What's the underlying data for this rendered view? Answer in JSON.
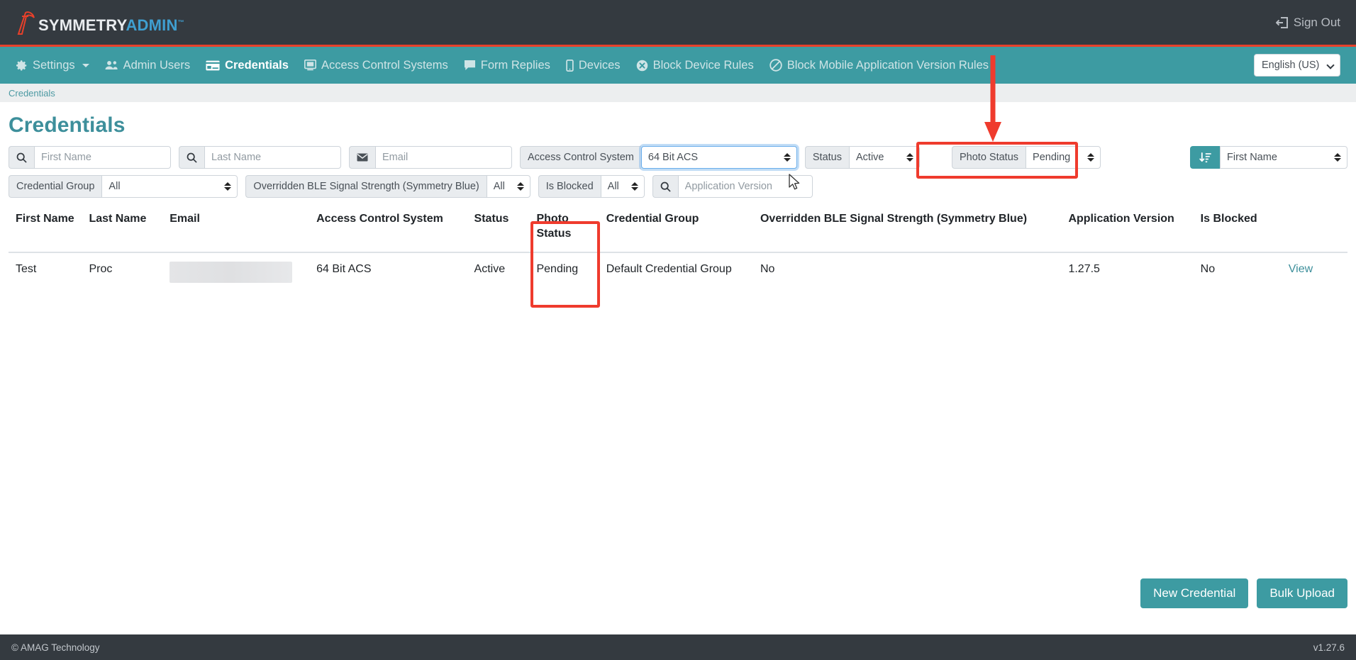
{
  "brand": {
    "logo_symmetry": "SYMMETRY",
    "logo_admin": "ADMIN",
    "logo_tm": "™",
    "accent_teal": "#3d9ba2",
    "accent_red": "#ef3b2d",
    "dark": "#343a40"
  },
  "topbar": {
    "signout_label": "Sign Out"
  },
  "nav": {
    "items": [
      {
        "label": "Settings",
        "icon": "gear-icon",
        "active": false,
        "caret": true
      },
      {
        "label": "Admin Users",
        "icon": "users-icon",
        "active": false
      },
      {
        "label": "Credentials",
        "icon": "card-icon",
        "active": true
      },
      {
        "label": "Access Control Systems",
        "icon": "server-icon",
        "active": false
      },
      {
        "label": "Form Replies",
        "icon": "comment-icon",
        "active": false
      },
      {
        "label": "Devices",
        "icon": "mobile-icon",
        "active": false
      },
      {
        "label": "Block Device Rules",
        "icon": "times-circle-icon",
        "active": false
      },
      {
        "label": "Block Mobile Application Version Rules",
        "icon": "ban-icon",
        "active": false
      }
    ],
    "language_selected": "English (US)"
  },
  "breadcrumb": {
    "text": "Credentials"
  },
  "page": {
    "title": "Credentials"
  },
  "filters": {
    "row1": [
      {
        "name": "first-name",
        "addon_icon": "search-icon",
        "type": "input",
        "placeholder": "First Name",
        "value": ""
      },
      {
        "name": "last-name",
        "addon_icon": "search-icon",
        "type": "input",
        "placeholder": "Last Name",
        "value": ""
      },
      {
        "name": "email",
        "addon_icon": "envelope-icon",
        "type": "input",
        "placeholder": "Email",
        "value": ""
      },
      {
        "name": "access-control-system",
        "addon_label": "Access Control System",
        "type": "select",
        "value": "64 Bit ACS",
        "focused": true
      },
      {
        "name": "status",
        "addon_label": "Status",
        "type": "select",
        "value": "Active"
      },
      {
        "name": "photo-status",
        "addon_label": "Photo Status",
        "type": "select",
        "value": "Pending",
        "highlighted": true
      }
    ],
    "sort": {
      "label": "First Name",
      "icon": "sort-amount-down-icon"
    },
    "row2": [
      {
        "name": "credential-group",
        "addon_label": "Credential Group",
        "type": "select",
        "value": "All"
      },
      {
        "name": "overridden-ble-signal-strength",
        "addon_label": "Overridden BLE Signal Strength (Symmetry Blue)",
        "type": "select",
        "value": "All"
      },
      {
        "name": "is-blocked",
        "addon_label": "Is Blocked",
        "type": "select",
        "value": "All"
      },
      {
        "name": "application-version",
        "addon_icon": "search-icon",
        "type": "input",
        "placeholder": "Application Version",
        "value": ""
      }
    ]
  },
  "table": {
    "columns": [
      "First Name",
      "Last Name",
      "Email",
      "Access Control System",
      "Status",
      "Photo Status",
      "Credential Group",
      "Overridden BLE Signal Strength (Symmetry Blue)",
      "Application Version",
      "Is Blocked",
      ""
    ],
    "rows": [
      {
        "first_name": "Test",
        "last_name": "Proc",
        "email": "",
        "email_redacted": true,
        "access_control_system": "64 Bit ACS",
        "status": "Active",
        "photo_status": "Pending",
        "credential_group": "Default Credential Group",
        "overridden_ble": "No",
        "application_version": "1.27.5",
        "is_blocked": "No",
        "action": "View"
      }
    ]
  },
  "actions": {
    "new_credential": "New Credential",
    "bulk_upload": "Bulk Upload"
  },
  "footer": {
    "copyright": "© AMAG Technology",
    "version": "v1.27.6"
  },
  "annotations": {
    "arrow": "red-down-arrow-pointing-to-photo-status-filter",
    "box_filter": "red-highlight-photo-status-filter",
    "box_column": "red-highlight-photo-status-column"
  }
}
